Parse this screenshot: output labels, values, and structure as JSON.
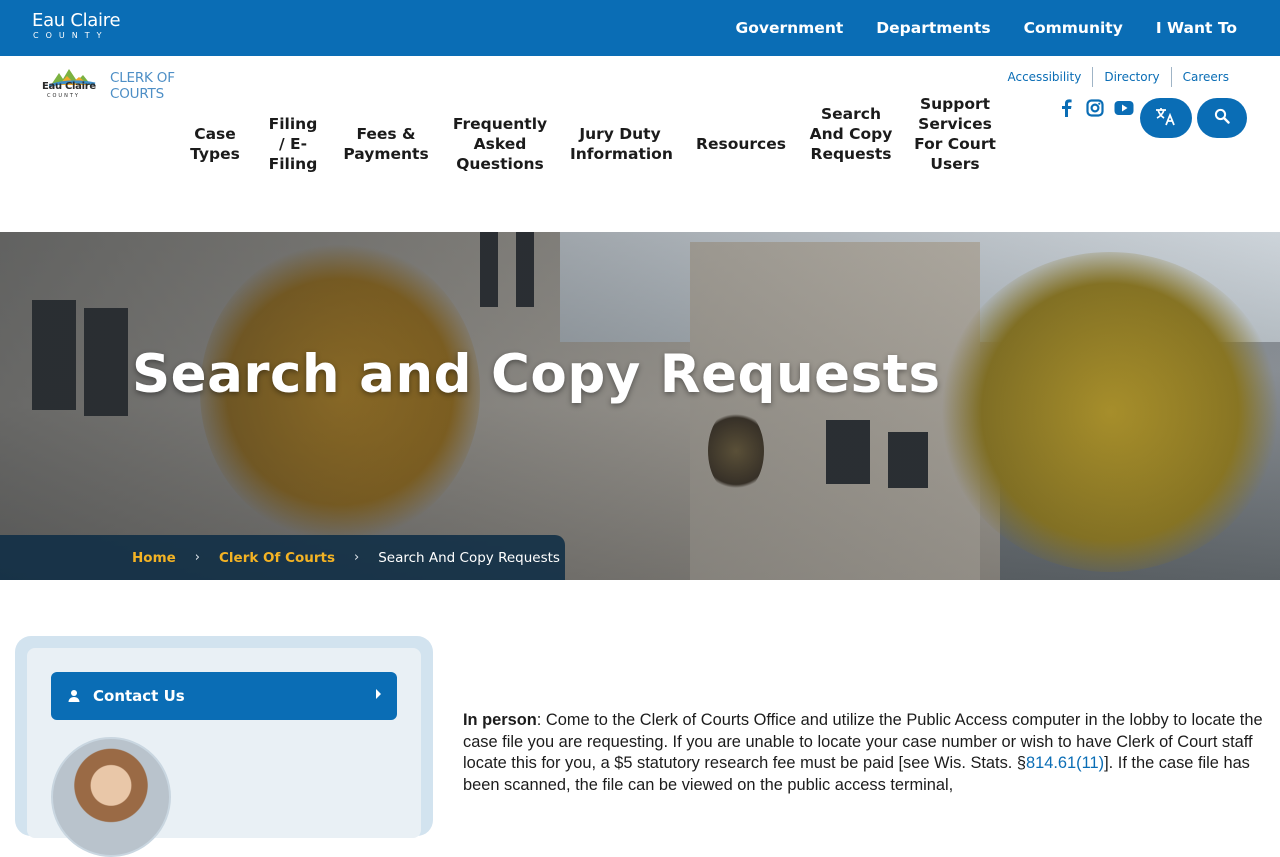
{
  "topbar": {
    "county_name": "Eau Claire",
    "county_sub": "COUNTY",
    "nav": [
      "Government",
      "Departments",
      "Community",
      "I Want To"
    ]
  },
  "header": {
    "logo_small": "Eau Claire",
    "logo_tiny": "COUNTY",
    "logo_title_1": "CLERK OF",
    "logo_title_2": "COURTS",
    "utility": [
      "Accessibility",
      "Directory",
      "Careers"
    ],
    "nav": [
      "Case Types",
      "Filing / E-Filing",
      "Fees & Payments",
      "Frequently Asked Questions",
      "Jury Duty Information",
      "Resources",
      "Search And Copy Requests",
      "Support Services For Court Users"
    ],
    "social_icons": [
      "facebook-icon",
      "instagram-icon",
      "youtube-icon"
    ],
    "translate_icon": "translate-icon",
    "search_icon": "search-icon"
  },
  "hero": {
    "title": "Search and Copy Requests",
    "breadcrumb": {
      "home": "Home",
      "parent": "Clerk Of Courts",
      "current": "Search And Copy Requests",
      "separator": "›"
    }
  },
  "sidebar": {
    "contact_label": "Contact Us"
  },
  "content": {
    "lead": "In person",
    "text_1": ": Come to the Clerk of Courts Office and utilize the Public Access computer in the lobby to locate the case file you are requesting. If you are unable to locate your case number or wish to have Clerk of Court staff locate this for you, a $5 statutory research fee must be paid [see Wis. Stats. §",
    "statute_link": "814.61(11)",
    "text_2": "]. If the case file has been scanned, the file can be viewed on the public access terminal,"
  },
  "colors": {
    "brand_blue": "#0a6db5",
    "breadcrumb_gold": "#f4b324"
  }
}
